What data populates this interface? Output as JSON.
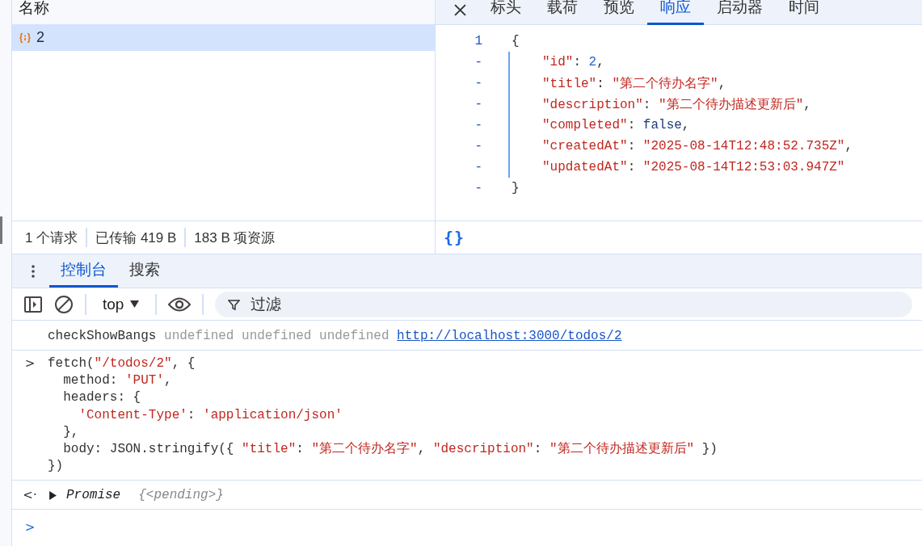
{
  "requests": {
    "column_header": "名称",
    "rows": [
      {
        "name": "2",
        "selected": true
      }
    ]
  },
  "summary": [
    "1 个请求",
    "已传输 419 B",
    "183 B 项资源"
  ],
  "detail_tabs": [
    {
      "label": "标头",
      "selected": false
    },
    {
      "label": "载荷",
      "selected": false
    },
    {
      "label": "预览",
      "selected": false
    },
    {
      "label": "响应",
      "selected": true
    },
    {
      "label": "启动器",
      "selected": false
    },
    {
      "label": "时间",
      "selected": false
    }
  ],
  "response": {
    "open": {
      "gutter": "1",
      "tokens": [
        {
          "kind": "punct",
          "text": "{"
        }
      ]
    },
    "children": [
      {
        "gutter": "-",
        "tokens": [
          {
            "kind": "str",
            "text": "\"id\""
          },
          {
            "kind": "punct",
            "text": ": "
          },
          {
            "kind": "num",
            "text": "2"
          },
          {
            "kind": "punct",
            "text": ","
          }
        ]
      },
      {
        "gutter": "-",
        "tokens": [
          {
            "kind": "str",
            "text": "\"title\""
          },
          {
            "kind": "punct",
            "text": ": "
          },
          {
            "kind": "str",
            "text": "\"第二个待办名字\""
          },
          {
            "kind": "punct",
            "text": ","
          }
        ]
      },
      {
        "gutter": "-",
        "tokens": [
          {
            "kind": "str",
            "text": "\"description\""
          },
          {
            "kind": "punct",
            "text": ": "
          },
          {
            "kind": "str",
            "text": "\"第二个待办描述更新后\""
          },
          {
            "kind": "punct",
            "text": ","
          }
        ]
      },
      {
        "gutter": "-",
        "tokens": [
          {
            "kind": "str",
            "text": "\"completed\""
          },
          {
            "kind": "punct",
            "text": ": "
          },
          {
            "kind": "kw",
            "text": "false"
          },
          {
            "kind": "punct",
            "text": ","
          }
        ]
      },
      {
        "gutter": "-",
        "tokens": [
          {
            "kind": "str",
            "text": "\"createdAt\""
          },
          {
            "kind": "punct",
            "text": ": "
          },
          {
            "kind": "str",
            "text": "\"2025-08-14T12:48:52.735Z\""
          },
          {
            "kind": "punct",
            "text": ","
          }
        ]
      },
      {
        "gutter": "-",
        "tokens": [
          {
            "kind": "str",
            "text": "\"updatedAt\""
          },
          {
            "kind": "punct",
            "text": ": "
          },
          {
            "kind": "str",
            "text": "\"2025-08-14T12:53:03.947Z\""
          }
        ]
      }
    ],
    "close": {
      "gutter": "-",
      "tokens": [
        {
          "kind": "punct",
          "text": "}"
        }
      ]
    }
  },
  "pretty_print": "{}",
  "drawer_tabs": [
    {
      "label": "控制台",
      "selected": true
    },
    {
      "label": "搜索",
      "selected": false
    }
  ],
  "console_toolbar": {
    "context": "top",
    "filter_placeholder": "过滤"
  },
  "console": [
    {
      "kind": "log",
      "lines": [
        [
          {
            "kind": "plain",
            "text": "checkShowBangs "
          },
          {
            "kind": "dim",
            "text": "undefined undefined undefined "
          },
          {
            "kind": "link",
            "text": "http://localhost:3000/todos/2"
          }
        ]
      ]
    },
    {
      "kind": "input",
      "prompt": ">",
      "lines": [
        [
          {
            "kind": "plain",
            "text": "fetch("
          },
          {
            "kind": "str",
            "text": "\"/todos/2\""
          },
          {
            "kind": "plain",
            "text": ", {"
          }
        ],
        [
          {
            "kind": "plain",
            "text": "  method: "
          },
          {
            "kind": "str",
            "text": "'PUT'"
          },
          {
            "kind": "plain",
            "text": ","
          }
        ],
        [
          {
            "kind": "plain",
            "text": "  headers: {"
          }
        ],
        [
          {
            "kind": "str",
            "text": "    'Content-Type'"
          },
          {
            "kind": "plain",
            "text": ": "
          },
          {
            "kind": "str",
            "text": "'application/json'"
          }
        ],
        [
          {
            "kind": "plain",
            "text": "  },"
          }
        ],
        [
          {
            "kind": "plain",
            "text": "  body: JSON.stringify({ "
          },
          {
            "kind": "str",
            "text": "\"title\""
          },
          {
            "kind": "plain",
            "text": ": "
          },
          {
            "kind": "str",
            "text": "\"第二个待办名字\""
          },
          {
            "kind": "plain",
            "text": ", "
          },
          {
            "kind": "str",
            "text": "\"description\""
          },
          {
            "kind": "plain",
            "text": ": "
          },
          {
            "kind": "str",
            "text": "\"第二个待办描述更新后\""
          },
          {
            "kind": "plain",
            "text": " })"
          }
        ],
        [
          {
            "kind": "plain",
            "text": "})"
          }
        ]
      ]
    },
    {
      "kind": "result",
      "prompt": "<·",
      "lines": [
        [
          {
            "kind": "italic",
            "text": "Promise"
          },
          {
            "kind": "dimitalic",
            "text": "{<pending>}"
          }
        ]
      ]
    },
    {
      "kind": "prompt",
      "prompt": ">"
    }
  ]
}
